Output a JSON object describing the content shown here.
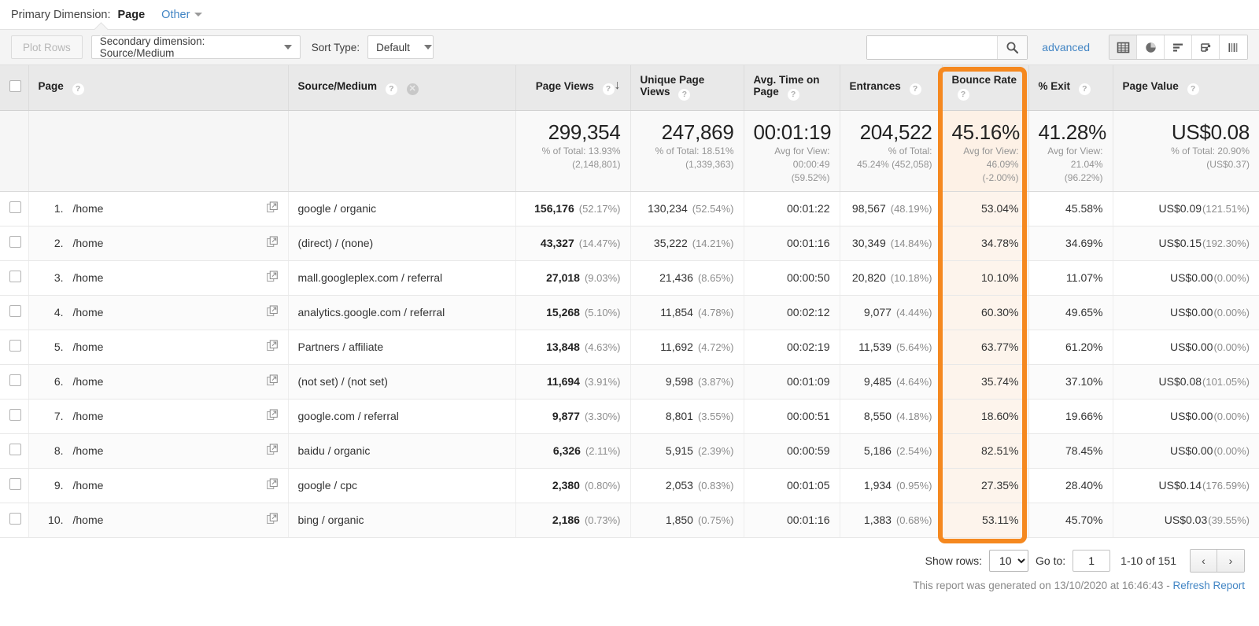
{
  "primary": {
    "label": "Primary Dimension:",
    "value": "Page",
    "other_label": "Other"
  },
  "controls": {
    "plot_rows": "Plot Rows",
    "secondary_dimension": "Secondary dimension: Source/Medium",
    "sort_type_label": "Sort Type:",
    "sort_type_value": "Default",
    "search_value": "",
    "search_placeholder": "",
    "advanced": "advanced",
    "view_icons": [
      "table-view-icon",
      "pie-chart-view-icon",
      "bar-chart-view-icon",
      "performance-view-icon",
      "comparison-view-icon"
    ]
  },
  "table": {
    "headers": {
      "page": "Page",
      "source_medium": "Source/Medium",
      "page_views": "Page Views",
      "unique_page_views": "Unique Page Views",
      "avg_time_on_page": "Avg. Time on Page",
      "entrances": "Entrances",
      "bounce_rate": "Bounce Rate",
      "exit_pct": "% Exit",
      "page_value": "Page Value"
    },
    "summary": {
      "page_views": {
        "value": "299,354",
        "line1": "% of Total: 13.93%",
        "line2": "(2,148,801)"
      },
      "unique_page_views": {
        "value": "247,869",
        "line1": "% of Total: 18.51%",
        "line2": "(1,339,363)"
      },
      "avg_time_on_page": {
        "value": "00:01:19",
        "line1": "Avg for View:",
        "line2": "00:00:49",
        "line3": "(59.52%)"
      },
      "entrances": {
        "value": "204,522",
        "line1": "% of Total:",
        "line2": "45.24% (452,058)"
      },
      "bounce_rate": {
        "value": "45.16%",
        "line1": "Avg for View:",
        "line2": "46.09%",
        "line3": "(-2.00%)"
      },
      "exit_pct": {
        "value": "41.28%",
        "line1": "Avg for View:",
        "line2": "21.04%",
        "line3": "(96.22%)"
      },
      "page_value": {
        "value": "US$0.08",
        "line1": "% of Total: 20.90%",
        "line2": "(US$0.37)"
      }
    },
    "rows": [
      {
        "num": "1.",
        "page": "/home",
        "source_medium": "google / organic",
        "page_views": "156,176",
        "page_views_pct": "(52.17%)",
        "unique_page_views": "130,234",
        "unique_page_views_pct": "(52.54%)",
        "avg_time": "00:01:22",
        "entrances": "98,567",
        "entrances_pct": "(48.19%)",
        "bounce_rate": "53.04%",
        "exit_pct": "45.58%",
        "page_value": "US$0.09",
        "page_value_pct": "(121.51%)"
      },
      {
        "num": "2.",
        "page": "/home",
        "source_medium": "(direct) / (none)",
        "page_views": "43,327",
        "page_views_pct": "(14.47%)",
        "unique_page_views": "35,222",
        "unique_page_views_pct": "(14.21%)",
        "avg_time": "00:01:16",
        "entrances": "30,349",
        "entrances_pct": "(14.84%)",
        "bounce_rate": "34.78%",
        "exit_pct": "34.69%",
        "page_value": "US$0.15",
        "page_value_pct": "(192.30%)"
      },
      {
        "num": "3.",
        "page": "/home",
        "source_medium": "mall.googleplex.com / referral",
        "page_views": "27,018",
        "page_views_pct": "(9.03%)",
        "unique_page_views": "21,436",
        "unique_page_views_pct": "(8.65%)",
        "avg_time": "00:00:50",
        "entrances": "20,820",
        "entrances_pct": "(10.18%)",
        "bounce_rate": "10.10%",
        "exit_pct": "11.07%",
        "page_value": "US$0.00",
        "page_value_pct": "(0.00%)"
      },
      {
        "num": "4.",
        "page": "/home",
        "source_medium": "analytics.google.com / referral",
        "page_views": "15,268",
        "page_views_pct": "(5.10%)",
        "unique_page_views": "11,854",
        "unique_page_views_pct": "(4.78%)",
        "avg_time": "00:02:12",
        "entrances": "9,077",
        "entrances_pct": "(4.44%)",
        "bounce_rate": "60.30%",
        "exit_pct": "49.65%",
        "page_value": "US$0.00",
        "page_value_pct": "(0.00%)"
      },
      {
        "num": "5.",
        "page": "/home",
        "source_medium": "Partners / affiliate",
        "page_views": "13,848",
        "page_views_pct": "(4.63%)",
        "unique_page_views": "11,692",
        "unique_page_views_pct": "(4.72%)",
        "avg_time": "00:02:19",
        "entrances": "11,539",
        "entrances_pct": "(5.64%)",
        "bounce_rate": "63.77%",
        "exit_pct": "61.20%",
        "page_value": "US$0.00",
        "page_value_pct": "(0.00%)"
      },
      {
        "num": "6.",
        "page": "/home",
        "source_medium": "(not set) / (not set)",
        "page_views": "11,694",
        "page_views_pct": "(3.91%)",
        "unique_page_views": "9,598",
        "unique_page_views_pct": "(3.87%)",
        "avg_time": "00:01:09",
        "entrances": "9,485",
        "entrances_pct": "(4.64%)",
        "bounce_rate": "35.74%",
        "exit_pct": "37.10%",
        "page_value": "US$0.08",
        "page_value_pct": "(101.05%)"
      },
      {
        "num": "7.",
        "page": "/home",
        "source_medium": "google.com / referral",
        "page_views": "9,877",
        "page_views_pct": "(3.30%)",
        "unique_page_views": "8,801",
        "unique_page_views_pct": "(3.55%)",
        "avg_time": "00:00:51",
        "entrances": "8,550",
        "entrances_pct": "(4.18%)",
        "bounce_rate": "18.60%",
        "exit_pct": "19.66%",
        "page_value": "US$0.00",
        "page_value_pct": "(0.00%)"
      },
      {
        "num": "8.",
        "page": "/home",
        "source_medium": "baidu / organic",
        "page_views": "6,326",
        "page_views_pct": "(2.11%)",
        "unique_page_views": "5,915",
        "unique_page_views_pct": "(2.39%)",
        "avg_time": "00:00:59",
        "entrances": "5,186",
        "entrances_pct": "(2.54%)",
        "bounce_rate": "82.51%",
        "exit_pct": "78.45%",
        "page_value": "US$0.00",
        "page_value_pct": "(0.00%)"
      },
      {
        "num": "9.",
        "page": "/home",
        "source_medium": "google / cpc",
        "page_views": "2,380",
        "page_views_pct": "(0.80%)",
        "unique_page_views": "2,053",
        "unique_page_views_pct": "(0.83%)",
        "avg_time": "00:01:05",
        "entrances": "1,934",
        "entrances_pct": "(0.95%)",
        "bounce_rate": "27.35%",
        "exit_pct": "28.40%",
        "page_value": "US$0.14",
        "page_value_pct": "(176.59%)"
      },
      {
        "num": "10.",
        "page": "/home",
        "source_medium": "bing / organic",
        "page_views": "2,186",
        "page_views_pct": "(0.73%)",
        "unique_page_views": "1,850",
        "unique_page_views_pct": "(0.75%)",
        "avg_time": "00:01:16",
        "entrances": "1,383",
        "entrances_pct": "(0.68%)",
        "bounce_rate": "53.11%",
        "exit_pct": "45.70%",
        "page_value": "US$0.03",
        "page_value_pct": "(39.55%)"
      }
    ]
  },
  "footer": {
    "show_rows_label": "Show rows:",
    "show_rows_value": "10",
    "goto_label": "Go to:",
    "goto_value": "1",
    "range": "1-10 of 151",
    "prev": "‹",
    "next": "›",
    "generated_text": "This report was generated on 13/10/2020 at 16:46:43 - ",
    "refresh_label": "Refresh Report"
  },
  "colors": {
    "highlight": "#f5881f",
    "link": "#4285c4",
    "header_bg": "#e9e9e9"
  }
}
